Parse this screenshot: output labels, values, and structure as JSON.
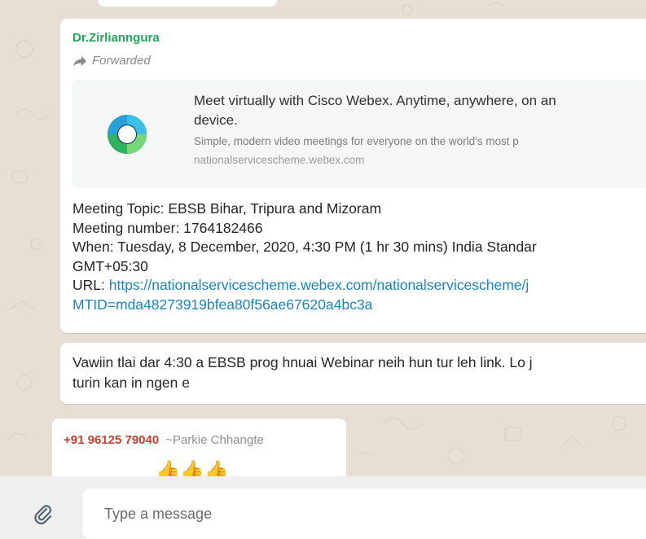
{
  "messages": {
    "forwarded_msg": {
      "sender": "Dr.Zirlianngura",
      "forwarded_label": "Forwarded",
      "forward_icon": "forward-arrow-icon",
      "link_preview": {
        "title_line1": "Meet virtually with Cisco Webex. Anytime, anywhere, on an",
        "title_line2": "device.",
        "description": "Simple, modern video meetings for everyone on the world's most p",
        "domain": "nationalservicescheme.webex.com",
        "thumbnail_icon": "webex-logo-icon"
      },
      "body_lines": {
        "topic": "Meeting Topic: EBSB Bihar, Tripura and Mizoram",
        "number": "Meeting number: 1764182466",
        "when": "When: Tuesday, 8 December, 2020, 4:30 PM (1 hr 30 mins) India Standar",
        "gmt": "GMT+05:30",
        "url_prefix": "URL: ",
        "url_part1": "https://nationalservicescheme.webex.com/nationalservicescheme/j",
        "url_part2": "MTID=mda48273919bfea80f56ae67620a4bc3a"
      }
    },
    "followup_msg": {
      "line1": "Vawiin tlai dar 4:30 a EBSB prog hnuai Webinar neih hun tur leh link. Lo j",
      "line2": "turin kan in ngen e"
    },
    "reply_msg": {
      "phone": "+91 96125 79040",
      "push_name": "~Parkie Chhangte",
      "emojis": "👍👍👍"
    }
  },
  "composer": {
    "placeholder": "Type a message",
    "attach_icon": "paperclip-icon"
  },
  "colors": {
    "chat_bg": "#e7dfd4",
    "sender_name": "#1fa855",
    "link": "#1a84c6",
    "phone": "#c7402f"
  }
}
